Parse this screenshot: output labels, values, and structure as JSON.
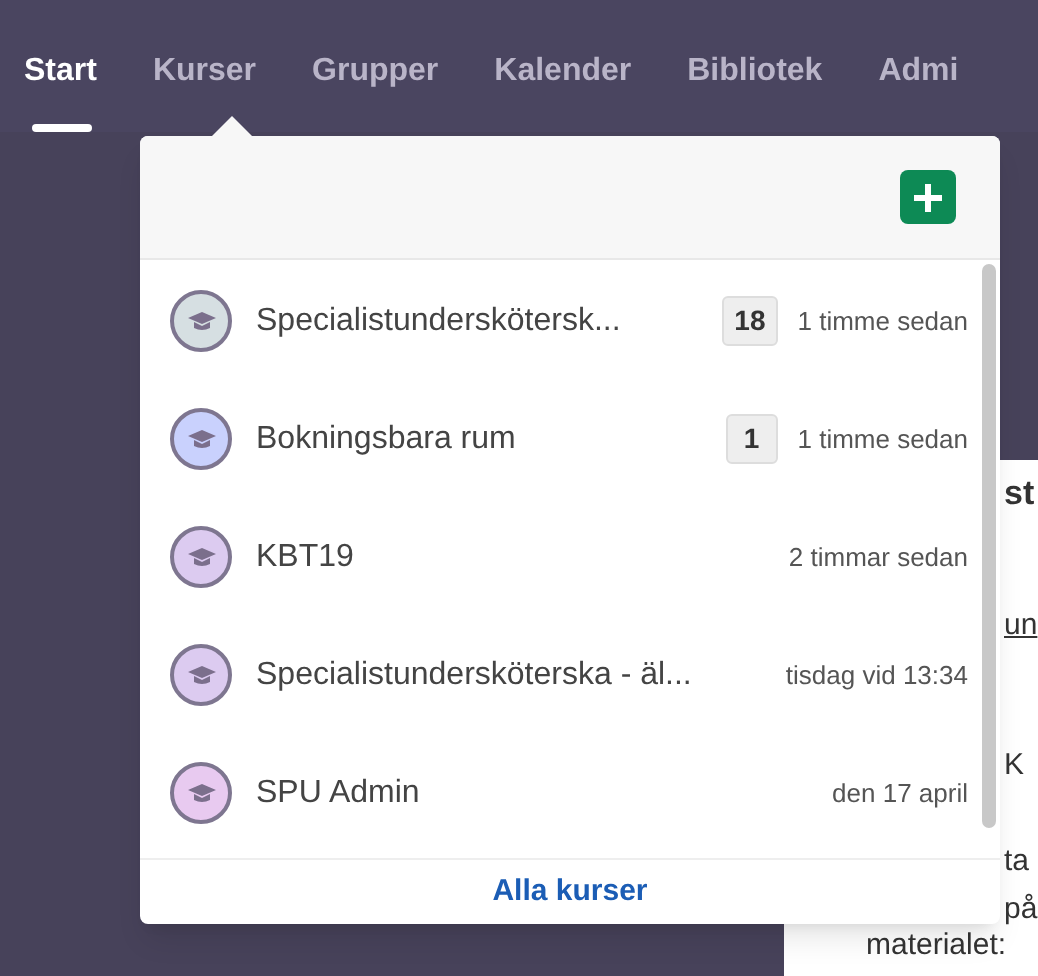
{
  "nav": {
    "tabs": [
      {
        "label": "Start",
        "selected": true
      },
      {
        "label": "Kurser",
        "selected": false
      },
      {
        "label": "Grupper",
        "selected": false
      },
      {
        "label": "Kalender",
        "selected": false
      },
      {
        "label": "Bibliotek",
        "selected": false
      },
      {
        "label": "Admi",
        "selected": false
      }
    ]
  },
  "background_panel": {
    "heading": "st",
    "texts": [
      {
        "text": "un",
        "kind": "link"
      },
      {
        "text": "K",
        "kind": "plain"
      },
      {
        "text": "ta",
        "kind": "plain"
      },
      {
        "text": "på",
        "kind": "plain"
      }
    ]
  },
  "background_footer_text": "materialet:",
  "courses_menu": {
    "items": [
      {
        "name": "Specialistunderskötersk...",
        "badge": "18",
        "time": "1 timme sedan",
        "color": "#d6dfe2"
      },
      {
        "name": "Bokningsbara rum",
        "badge": "1",
        "time": "1 timme sedan",
        "color": "#c9d1fd"
      },
      {
        "name": "KBT19",
        "time": "2 timmar sedan",
        "color": "#dccbf0"
      },
      {
        "name": "Specialistundersköterska - äl...",
        "time": "tisdag vid 13:34",
        "color": "#dccbf0"
      },
      {
        "name": "SPU Admin",
        "time": "den 17 april",
        "color": "#e8caf0"
      }
    ],
    "footer_link": "Alla kurser"
  }
}
